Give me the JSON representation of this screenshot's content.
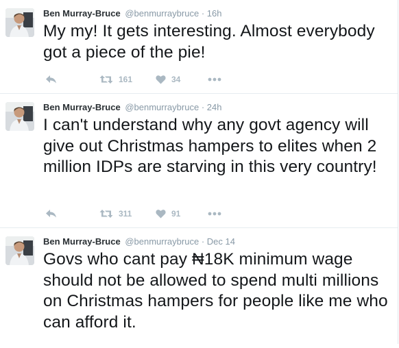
{
  "tweets": [
    {
      "name": "Ben Murray-Bruce",
      "handle": "@benmurraybruce",
      "separator": "·",
      "time": "16h",
      "text": "My my! It gets interesting. Almost everybody got a piece of the pie!",
      "retweets": "161",
      "likes": "34"
    },
    {
      "name": "Ben Murray-Bruce",
      "handle": "@benmurraybruce",
      "separator": "·",
      "time": "24h",
      "text": "I can't understand why any govt agency will give out Christmas hampers to elites when 2 million IDPs are starving in this very country!",
      "retweets": "311",
      "likes": "91"
    },
    {
      "name": "Ben Murray-Bruce",
      "handle": "@benmurraybruce",
      "separator": "·",
      "time": "Dec 14",
      "text": "Govs who cant pay ₦18K minimum wage should not be allowed to spend multi millions on Christmas hampers for people like me who can afford it."
    }
  ],
  "icons": {
    "reply": "reply-icon",
    "retweet": "retweet-icon",
    "like": "heart-icon",
    "more": "more-icon"
  },
  "colors": {
    "name": "#292f33",
    "meta": "#8899a6",
    "text": "#14171a",
    "action": "#aab8c2",
    "divider": "#e6ecf0"
  }
}
